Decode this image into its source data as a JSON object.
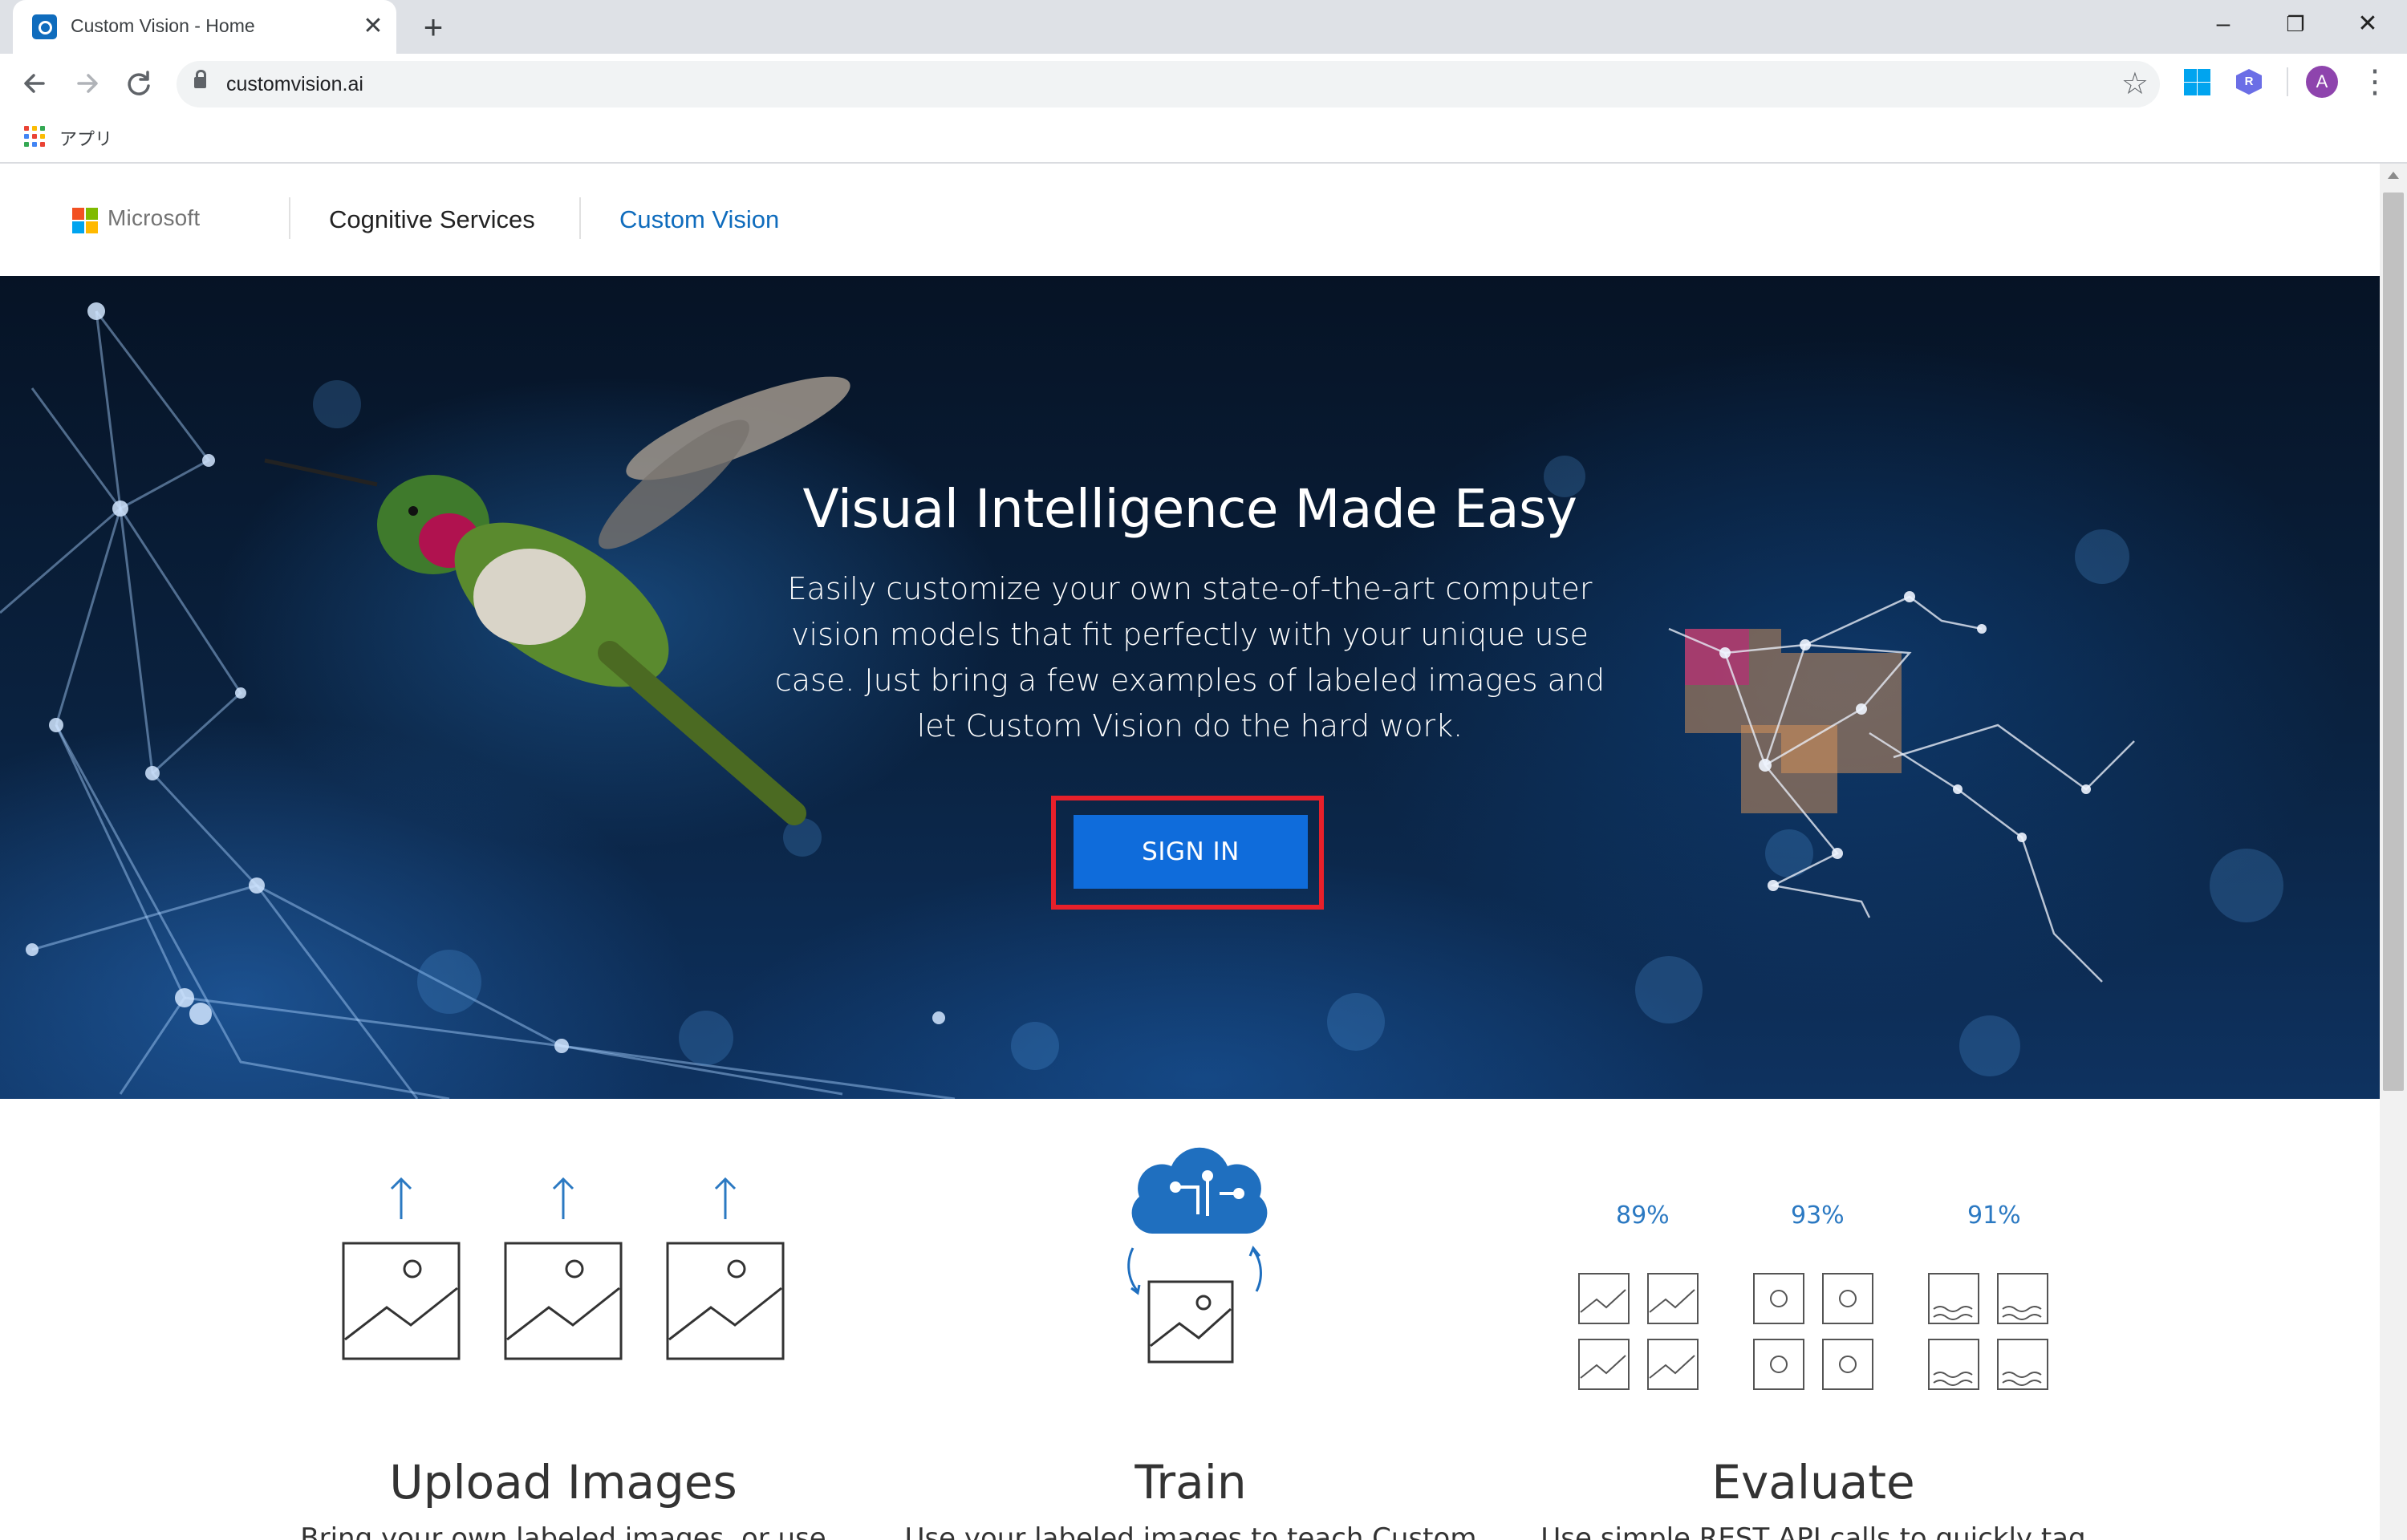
{
  "browser": {
    "tab_title": "Custom Vision - Home",
    "tab_close": "✕",
    "new_tab": "+",
    "url": "customvision.ai",
    "bookmarks_apps_label": "アプリ",
    "avatar_letter": "A",
    "r_extension_letter": "R",
    "window_controls": [
      "–",
      "❐",
      "✕"
    ],
    "icons": [
      "back-arrow-icon",
      "forward-arrow-icon",
      "reload-icon",
      "lock-icon",
      "star-icon",
      "windows-icon",
      "extension-r-icon",
      "menu-kebab-icon",
      "apps-grid-icon"
    ]
  },
  "header": {
    "brand": "Microsoft",
    "nav": [
      "Cognitive Services",
      "Custom Vision"
    ],
    "accent_color": "#0f6cbd"
  },
  "hero": {
    "title": "Visual Intelligence Made Easy",
    "description": "Easily customize your own state-of-the-art computer vision models that fit perfectly with your unique use case. Just bring a few examples of labeled images and let Custom Vision do the hard work.",
    "signin_label": "SIGN IN",
    "button_color": "#0f6cdb",
    "highlight_color": "#e8202a"
  },
  "features": [
    {
      "title": "Upload Images",
      "text": "Bring your own labeled images, or use"
    },
    {
      "title": "Train",
      "text": "Use your labeled images to teach Custom"
    },
    {
      "title": "Evaluate",
      "text": "Use simple REST API calls to quickly tag",
      "percentages": [
        "89%",
        "93%",
        "91%"
      ]
    }
  ]
}
